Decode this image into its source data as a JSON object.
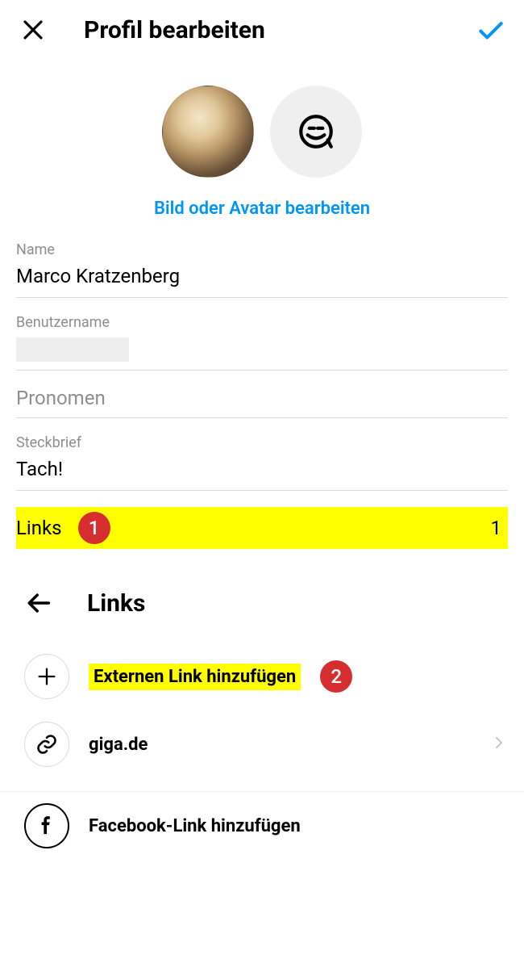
{
  "header": {
    "title": "Profil bearbeiten"
  },
  "editPicture": "Bild oder Avatar bearbeiten",
  "fields": {
    "nameLabel": "Name",
    "nameValue": "Marco Kratzenberg",
    "usernameLabel": "Benutzername",
    "pronounsPlaceholder": "Pronomen",
    "bioLabel": "Steckbrief",
    "bioValue": "Tach!"
  },
  "linksRow": {
    "label": "Links",
    "marker": "1",
    "count": "1"
  },
  "subheader": {
    "title": "Links"
  },
  "linkItems": {
    "addExternal": "Externen Link hinzufügen",
    "addExternalMarker": "2",
    "existing": "giga.de",
    "facebook": "Facebook-Link hinzufügen"
  }
}
